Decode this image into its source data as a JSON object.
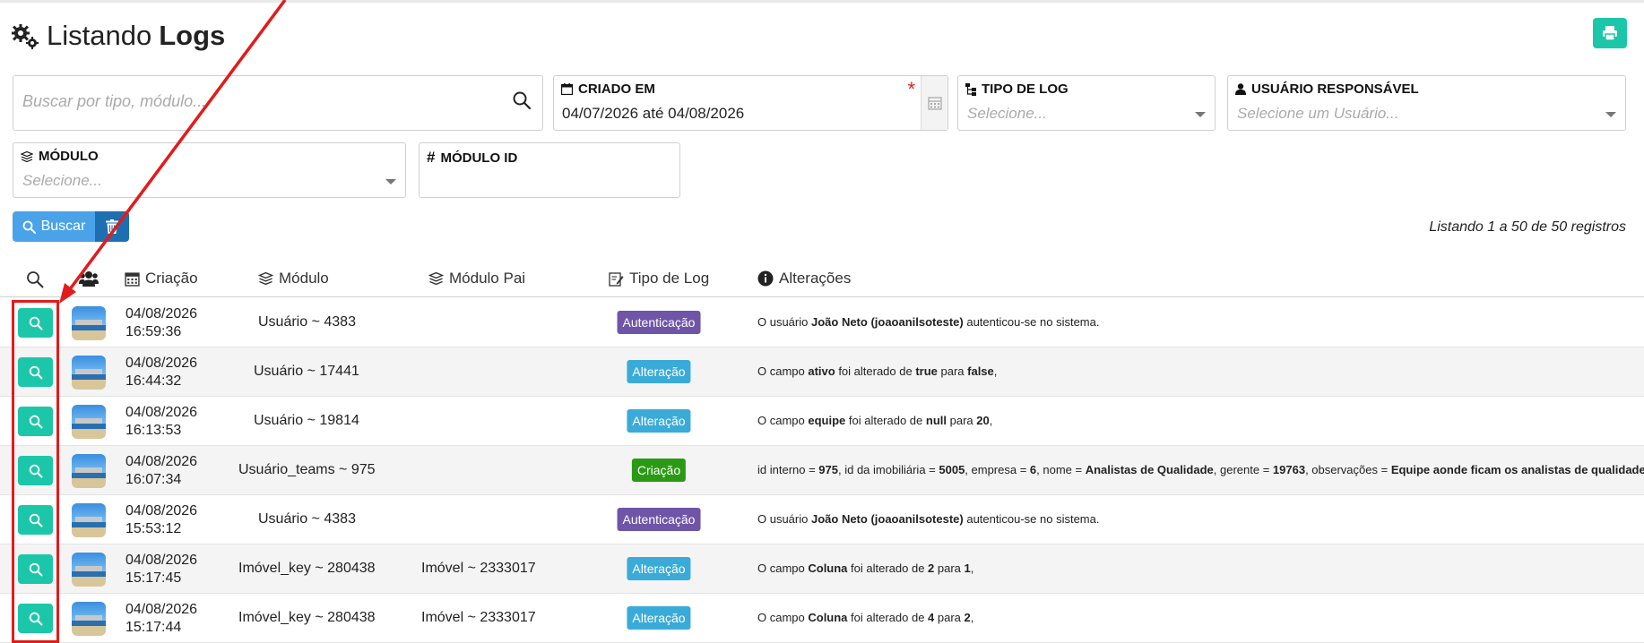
{
  "page": {
    "title_prefix": "Listando",
    "title_bold": "Logs"
  },
  "filters": {
    "search_placeholder": "Buscar por tipo, módulo...",
    "criado_em_label": "CRIADO EM",
    "criado_em_required": "*",
    "criado_em_value": "04/07/2026 até 04/08/2026",
    "tipo_log_label": "TIPO DE LOG",
    "tipo_log_placeholder": "Selecione...",
    "usuario_label": "USUÁRIO RESPONSÁVEL",
    "usuario_placeholder": "Selecione um Usuário...",
    "modulo_label": "MÓDULO",
    "modulo_placeholder": "Selecione...",
    "modulo_id_label": "MÓDULO ID",
    "modulo_id_value": ""
  },
  "actions": {
    "buscar_label": "Buscar"
  },
  "listing_text": "Listando 1 a 50 de 50 registros",
  "table": {
    "headers": {
      "criacao": "Criação",
      "modulo": "Módulo",
      "modulo_pai": "Módulo Pai",
      "tipo": "Tipo de Log",
      "alteracoes": "Alterações"
    },
    "rows": [
      {
        "date": "04/08/2026",
        "time": "16:59:36",
        "modulo": "Usuário ~ 4383",
        "modulo_pai": "",
        "tipo": "Autenticação",
        "tipo_kind": "auth",
        "alt": [
          [
            "t",
            "O usuário "
          ],
          [
            "b",
            "João Neto (joaoanilsoteste)"
          ],
          [
            "t",
            " autenticou-se no sistema."
          ]
        ]
      },
      {
        "date": "04/08/2026",
        "time": "16:44:32",
        "modulo": "Usuário ~ 17441",
        "modulo_pai": "",
        "tipo": "Alteração",
        "tipo_kind": "alt",
        "alt": [
          [
            "t",
            "O campo "
          ],
          [
            "b",
            "ativo"
          ],
          [
            "t",
            " foi alterado de "
          ],
          [
            "b",
            "true"
          ],
          [
            "t",
            " para "
          ],
          [
            "b",
            "false"
          ],
          [
            "t",
            ","
          ]
        ]
      },
      {
        "date": "04/08/2026",
        "time": "16:13:53",
        "modulo": "Usuário ~ 19814",
        "modulo_pai": "",
        "tipo": "Alteração",
        "tipo_kind": "alt",
        "alt": [
          [
            "t",
            "O campo "
          ],
          [
            "b",
            "equipe"
          ],
          [
            "t",
            " foi alterado de "
          ],
          [
            "b",
            "null"
          ],
          [
            "t",
            " para "
          ],
          [
            "b",
            "20"
          ],
          [
            "t",
            ","
          ]
        ]
      },
      {
        "date": "04/08/2026",
        "time": "16:07:34",
        "modulo": "Usuário_teams ~ 975",
        "modulo_pai": "",
        "tipo": "Criação",
        "tipo_kind": "cri",
        "alt": [
          [
            "t",
            "id interno = "
          ],
          [
            "b",
            "975"
          ],
          [
            "t",
            ", id da imobiliária = "
          ],
          [
            "b",
            "5005"
          ],
          [
            "t",
            ", empresa = "
          ],
          [
            "b",
            "6"
          ],
          [
            "t",
            ", nome = "
          ],
          [
            "b",
            "Analistas de Qualidade"
          ],
          [
            "t",
            ", gerente = "
          ],
          [
            "b",
            "19763"
          ],
          [
            "t",
            ", observações = "
          ],
          [
            "b",
            "Equipe aonde ficam os analistas de qualidade"
          ]
        ]
      },
      {
        "date": "04/08/2026",
        "time": "15:53:12",
        "modulo": "Usuário ~ 4383",
        "modulo_pai": "",
        "tipo": "Autenticação",
        "tipo_kind": "auth",
        "alt": [
          [
            "t",
            "O usuário "
          ],
          [
            "b",
            "João Neto (joaoanilsoteste)"
          ],
          [
            "t",
            " autenticou-se no sistema."
          ]
        ]
      },
      {
        "date": "04/08/2026",
        "time": "15:17:45",
        "modulo": "Imóvel_key ~ 280438",
        "modulo_pai": "Imóvel ~ 2333017",
        "tipo": "Alteração",
        "tipo_kind": "alt",
        "alt": [
          [
            "t",
            "O campo "
          ],
          [
            "b",
            "Coluna"
          ],
          [
            "t",
            " foi alterado de "
          ],
          [
            "b",
            "2"
          ],
          [
            "t",
            " para "
          ],
          [
            "b",
            "1"
          ],
          [
            "t",
            ","
          ]
        ]
      },
      {
        "date": "04/08/2026",
        "time": "15:17:44",
        "modulo": "Imóvel_key ~ 280438",
        "modulo_pai": "Imóvel ~ 2333017",
        "tipo": "Alteração",
        "tipo_kind": "alt",
        "alt": [
          [
            "t",
            "O campo "
          ],
          [
            "b",
            "Coluna"
          ],
          [
            "t",
            " foi alterado de "
          ],
          [
            "b",
            "4"
          ],
          [
            "t",
            " para "
          ],
          [
            "b",
            "2"
          ],
          [
            "t",
            ","
          ]
        ]
      }
    ]
  },
  "colors": {
    "accent_teal": "#1cc7a9",
    "buscar_blue": "#4aa3e8",
    "clear_blue": "#1d6fb1",
    "badge_autenticacao": "#6f55a8",
    "badge_alteracao": "#3aabd8",
    "badge_criacao": "#2a9a14",
    "annotation_red": "#e21b1b"
  },
  "icons": {
    "title": "gears-icon",
    "print": "print-icon",
    "search": "search-icon",
    "calendar": "calendar-icon",
    "tipo_log": "hierarchy-icon",
    "usuario": "user-icon",
    "modulo": "layers-icon",
    "modulo_id": "hash-icon",
    "clear": "trash-icon",
    "users_column": "users-icon",
    "tipo_column": "edit-document-icon",
    "alteracoes_column": "info-icon"
  }
}
